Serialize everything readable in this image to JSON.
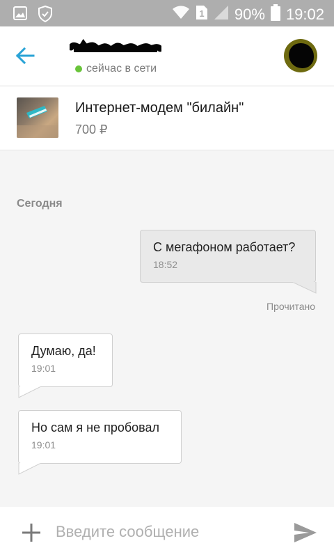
{
  "status_bar": {
    "battery": "90%",
    "time": "19:02",
    "sim_badge": "1",
    "icons": [
      "gallery-icon",
      "shield-check-icon",
      "wifi-icon",
      "sim-icon",
      "signal-icon",
      "battery-icon"
    ]
  },
  "header": {
    "contact_name": "",
    "presence": "сейчас в сети",
    "presence_color": "#69c43a",
    "accent": "#29a3d6"
  },
  "item": {
    "title": "Интернет-модем \"билайн\"",
    "price": "700 ₽"
  },
  "chat": {
    "date_label": "Сегодня",
    "read_receipt": "Прочитано",
    "messages": [
      {
        "direction": "out",
        "text": "С мегафоном работает?",
        "time": "18:52"
      },
      {
        "direction": "in",
        "text": "Думаю, да!",
        "time": "19:01"
      },
      {
        "direction": "in",
        "text": "Но сам я не пробовал",
        "time": "19:01"
      }
    ]
  },
  "composer": {
    "placeholder": "Введите сообщение"
  }
}
